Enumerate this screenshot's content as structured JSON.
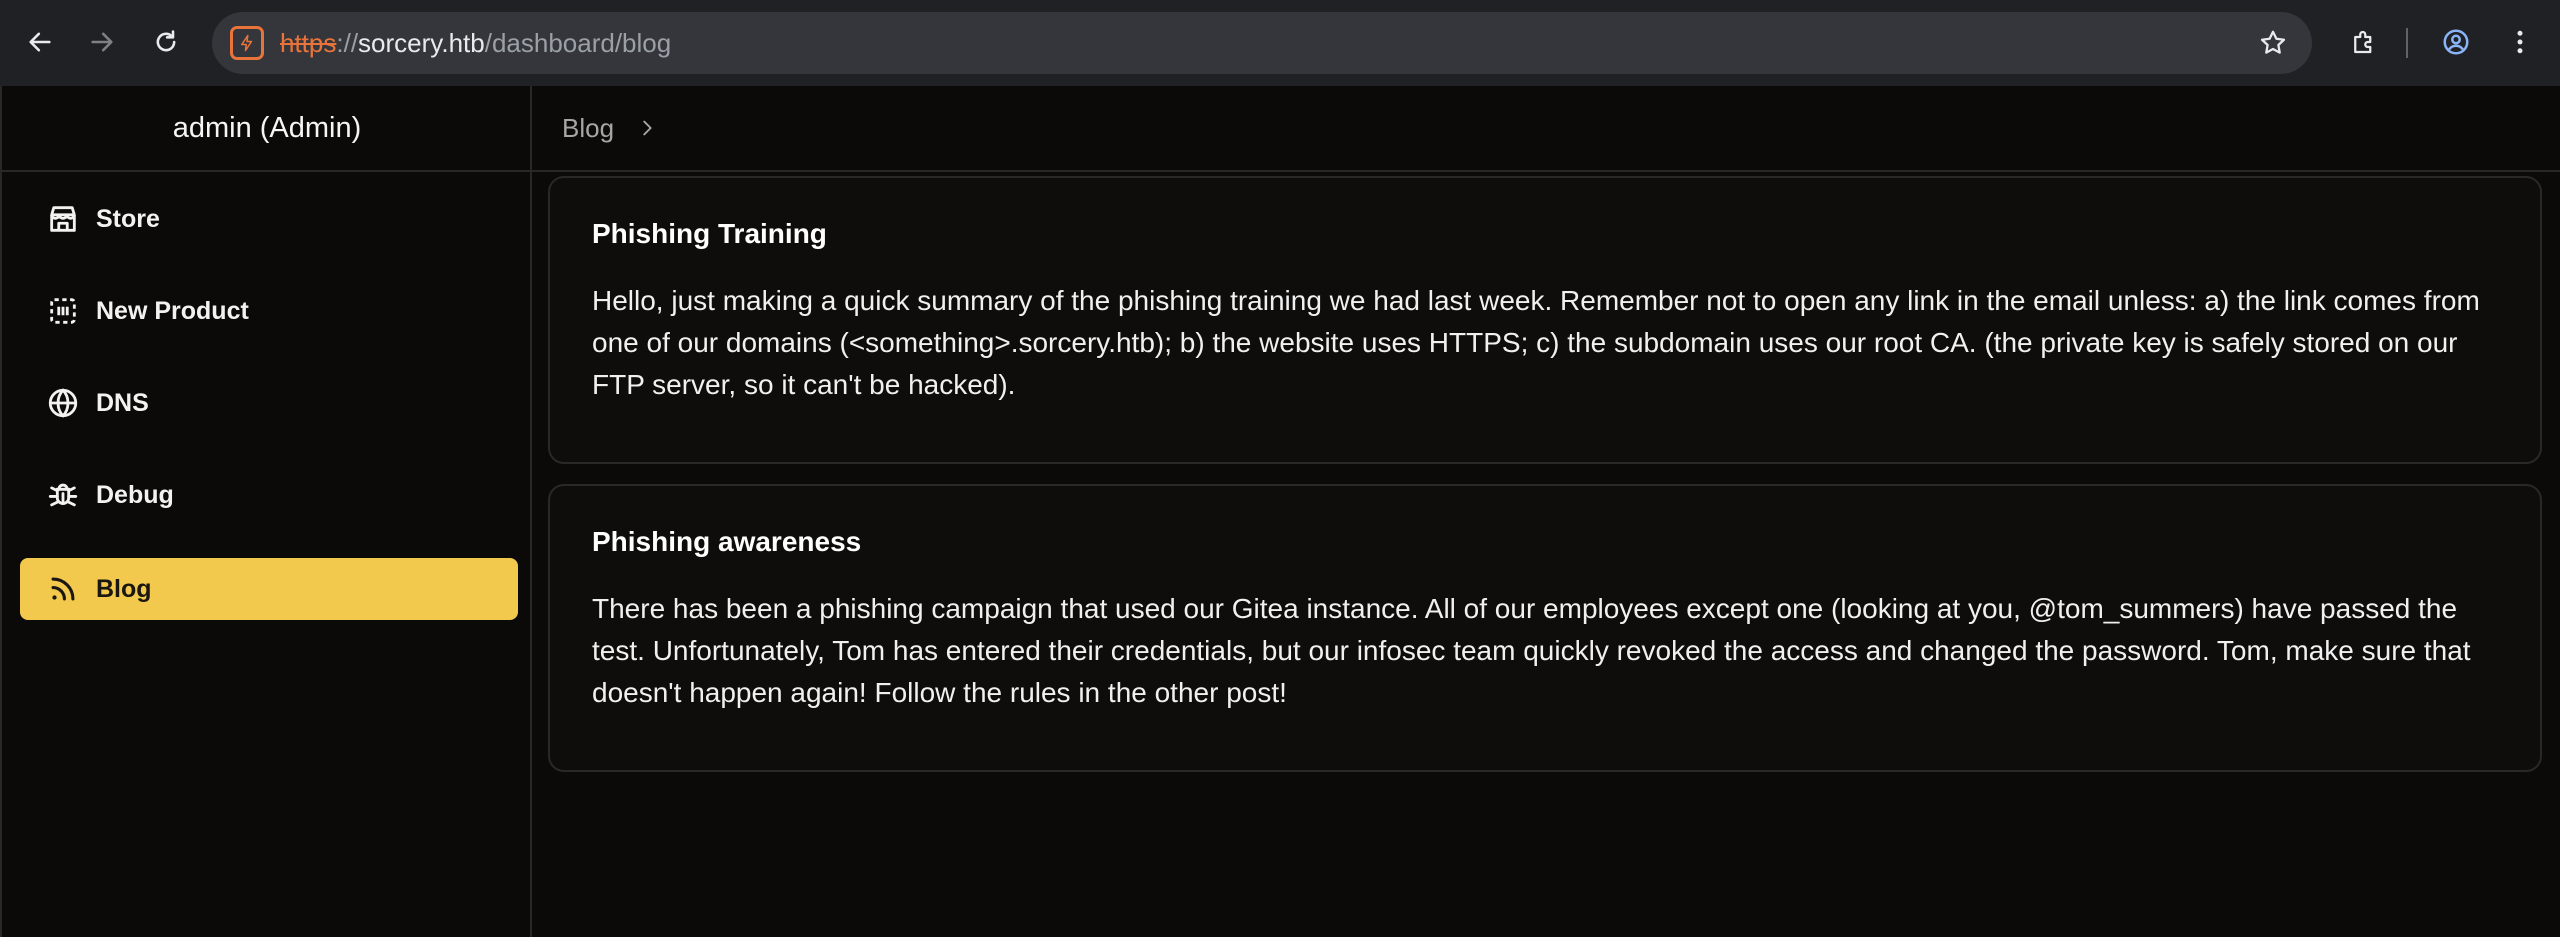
{
  "browser": {
    "url_scheme": "https",
    "url_sep": "://",
    "url_host": "sorcery.htb",
    "url_path": "/dashboard/blog"
  },
  "sidebar": {
    "header": "admin (Admin)",
    "items": [
      {
        "label": "Store",
        "icon": "store-icon"
      },
      {
        "label": "New Product",
        "icon": "new-product-icon"
      },
      {
        "label": "DNS",
        "icon": "globe-icon"
      },
      {
        "label": "Debug",
        "icon": "bug-icon"
      },
      {
        "label": "Blog",
        "icon": "rss-icon",
        "active": true
      }
    ]
  },
  "breadcrumb": {
    "label": "Blog"
  },
  "posts": [
    {
      "title": "Phishing Training",
      "body": "Hello, just making a quick summary of the phishing training we had last week. Remember not to open any link in the email unless: a) the link comes from one of our domains (<something>.sorcery.htb); b) the website uses HTTPS; c) the subdomain uses our root CA. (the private key is safely stored on our FTP server, so it can't be hacked)."
    },
    {
      "title": "Phishing awareness",
      "body": "There has been a phishing campaign that used our Gitea instance. All of our employees except one (looking at you, @tom_summers) have passed the test. Unfortunately, Tom has entered their credentials, but our infosec team quickly revoked the access and changed the password. Tom, make sure that doesn't happen again! Follow the rules in the other post!"
    }
  ],
  "colors": {
    "accent": "#f2c94c",
    "background": "#0b0a09",
    "insecure_scheme": "#e8743b"
  }
}
